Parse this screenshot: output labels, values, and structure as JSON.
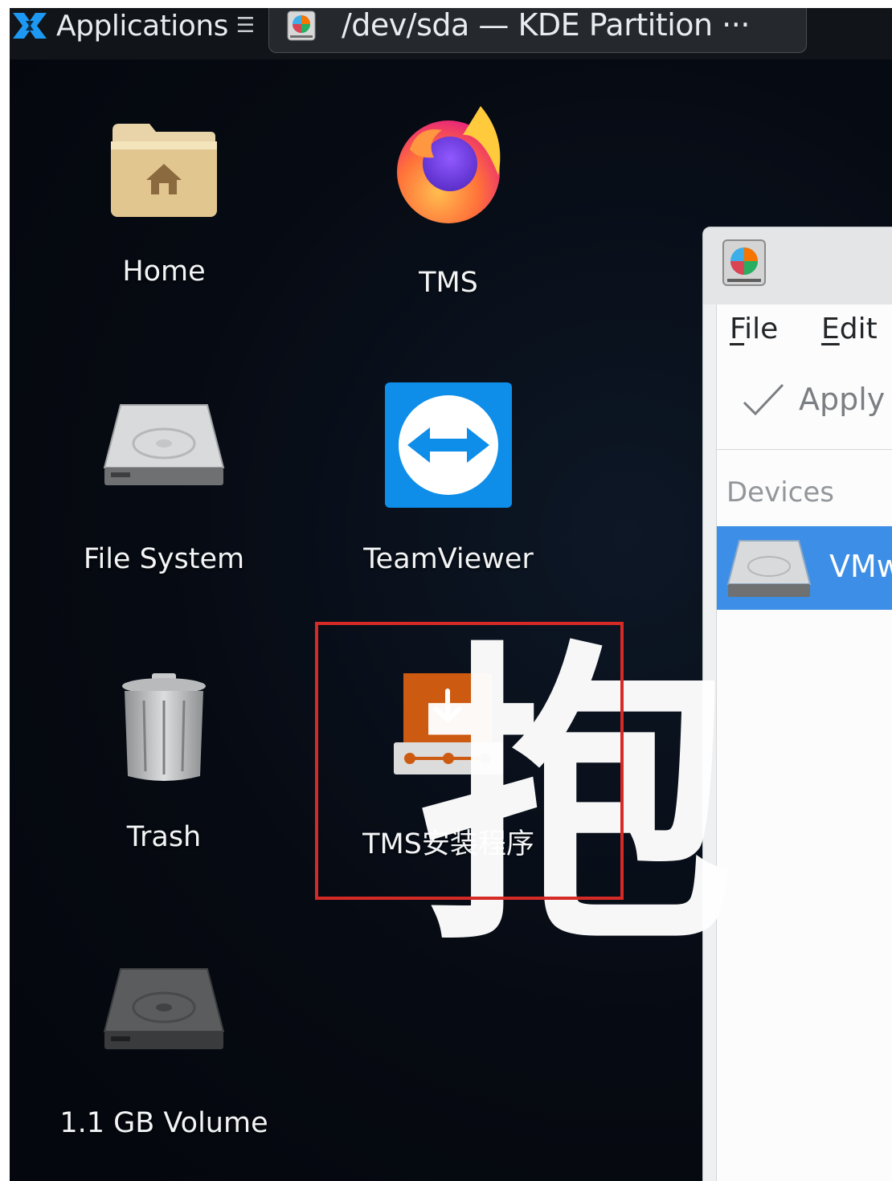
{
  "panel": {
    "launcher_label": "Applications",
    "launcher_menu_glyph": "☰",
    "task_label": "/dev/sda — KDE Partition ···"
  },
  "desktop": {
    "icons": [
      {
        "label": "Home",
        "icon": "home-folder-icon"
      },
      {
        "label": "TMS",
        "icon": "firefox-icon"
      },
      {
        "label": "File System",
        "icon": "hard-drive-icon"
      },
      {
        "label": "TeamViewer",
        "icon": "teamviewer-icon"
      },
      {
        "label": "Trash",
        "icon": "trash-icon"
      },
      {
        "label": "TMS安装程序",
        "icon": "installer-icon"
      },
      {
        "label": "1.1 GB Volume",
        "icon": "volume-drive-icon"
      }
    ]
  },
  "overlay": {
    "drag_glyph": "抱",
    "highlight_color": "#d62a26"
  },
  "partition_manager": {
    "menu": [
      "File",
      "Edit"
    ],
    "toolbar_apply": "Apply",
    "devices_heading": "Devices",
    "device_name": "VMw",
    "selection_color": "#3d8ee6"
  }
}
